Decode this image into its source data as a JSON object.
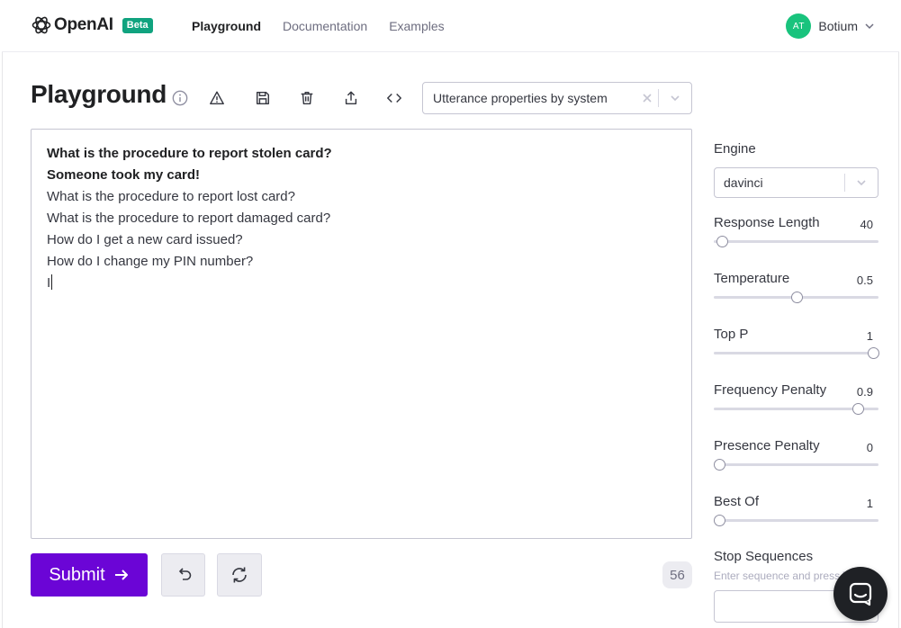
{
  "header": {
    "logo_text": "OpenAI",
    "beta_label": "Beta",
    "nav": [
      {
        "label": "Playground",
        "active": true
      },
      {
        "label": "Documentation",
        "active": false
      },
      {
        "label": "Examples",
        "active": false
      }
    ],
    "user": {
      "initials": "AT",
      "name": "Botium"
    }
  },
  "title": "Playground",
  "preset": {
    "value": "Utterance properties by system"
  },
  "editor": {
    "bold_lines": [
      "What is the procedure to report stolen card?",
      "Someone took my card!"
    ],
    "lines": [
      "What is the procedure to report lost card?",
      "What is the procedure to report damaged card?",
      "How do I get a new card issued?",
      "How do I change my PIN number?"
    ],
    "current_line": "I"
  },
  "actions": {
    "submit_label": "Submit",
    "token_count": "56"
  },
  "settings": {
    "engine_label": "Engine",
    "engine_value": "davinci",
    "params": [
      {
        "label": "Response Length",
        "value": "40",
        "fraction": 0.02
      },
      {
        "label": "Temperature",
        "value": "0.5",
        "fraction": 0.5
      },
      {
        "label": "Top P",
        "value": "1",
        "fraction": 1.0
      },
      {
        "label": "Frequency Penalty",
        "value": "0.9",
        "fraction": 0.9
      },
      {
        "label": "Presence Penalty",
        "value": "0",
        "fraction": 0.0
      },
      {
        "label": "Best Of",
        "value": "1",
        "fraction": 0.0
      }
    ],
    "stop_label": "Stop Sequences",
    "stop_hint": "Enter sequence and press Tab"
  },
  "colors": {
    "accent": "#6b05d6",
    "brand": "#10a37f",
    "avatar": "#19c37d"
  }
}
